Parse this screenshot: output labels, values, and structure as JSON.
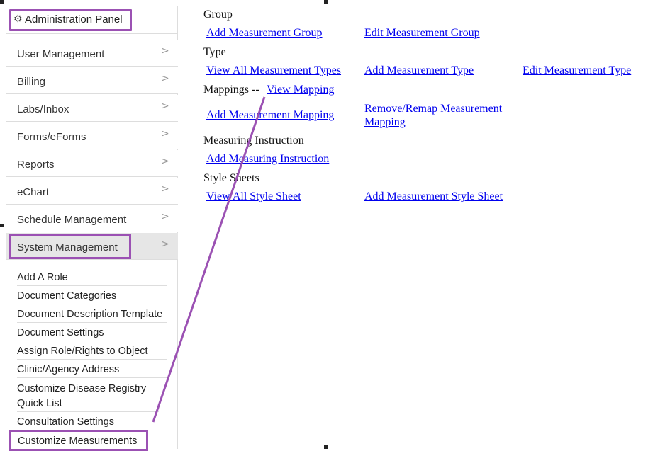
{
  "sidebar": {
    "header": {
      "icon": "gear-icon",
      "title": "Administration Panel"
    },
    "items": [
      {
        "label": "User Management"
      },
      {
        "label": "Billing"
      },
      {
        "label": "Labs/Inbox"
      },
      {
        "label": "Forms/eForms"
      },
      {
        "label": "Reports"
      },
      {
        "label": "eChart"
      },
      {
        "label": "Schedule Management"
      },
      {
        "label": "System Management"
      }
    ],
    "chevron": ">",
    "subitems": [
      {
        "label": "Add A Role"
      },
      {
        "label": "Document Categories"
      },
      {
        "label": "Document Description Template"
      },
      {
        "label": "Document Settings"
      },
      {
        "label": "Assign Role/Rights to Object"
      },
      {
        "label": "Clinic/Agency Address"
      },
      {
        "label": "Customize Disease Registry Quick List"
      },
      {
        "label": "Consultation Settings"
      },
      {
        "label": "Customize Measurements"
      }
    ]
  },
  "content": {
    "group": {
      "heading": "Group",
      "add": "Add Measurement Group",
      "edit": "Edit Measurement Group"
    },
    "type": {
      "heading": "Type",
      "view_all": "View All Measurement Types",
      "add": "Add Measurement Type",
      "edit": "Edit Measurement Type"
    },
    "mappings": {
      "heading": "Mappings --",
      "view": "View Mapping",
      "add": "Add Measurement Mapping",
      "remove_line1": "Remove/Remap Measurement",
      "remove_line2": "Mapping"
    },
    "instruction": {
      "heading": "Measuring Instruction",
      "add": "Add Measuring Instruction"
    },
    "stylesheets": {
      "heading": "Style Sheets",
      "view_all": "View All Style Sheet",
      "add": "Add Measurement Style Sheet"
    }
  },
  "colors": {
    "highlight": "#9b51b3",
    "link": "#0000ee"
  }
}
